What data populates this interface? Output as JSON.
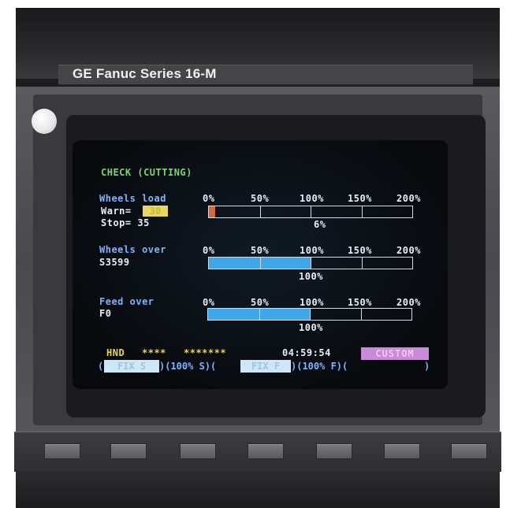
{
  "bezel": {
    "brand": "GE Fanuc Series 16-M",
    "softkey_count": 7
  },
  "screen": {
    "title": "CHECK (CUTTING)",
    "scale": [
      "0%",
      "50%",
      "100%",
      "150%",
      "200%"
    ],
    "wheels_load": {
      "label": "Wheels load",
      "warn_label": "Warn=",
      "warn_value": "30",
      "stop_label": "Stop= 35",
      "value_label": "6%",
      "percent": 6
    },
    "wheels_over": {
      "label": "Wheels over",
      "code": "S3599",
      "value_label": "100%",
      "percent": 100
    },
    "feed_over": {
      "label": "Feed over",
      "code": "F0",
      "value_label": "100%",
      "percent": 100
    },
    "status": {
      "mode": "HND",
      "stars_short": "****",
      "stars_long": "*******",
      "time": "04:59:54",
      "custom_label": "CUSTOM"
    },
    "menu": {
      "open1": "(",
      "fix_s": "FIX S",
      "mid1": ")(100% S)(",
      "fix_f": "FIX F",
      "mid2": ")(100% F)(",
      "close": ")"
    }
  },
  "colors": {
    "title": "#7fd07a",
    "label": "#7fb2ff",
    "bar_fill": "#3fa6e8",
    "load_fill": "#d46a3a",
    "status_yellow": "#e6d64a",
    "custom": "#c98ad8"
  }
}
